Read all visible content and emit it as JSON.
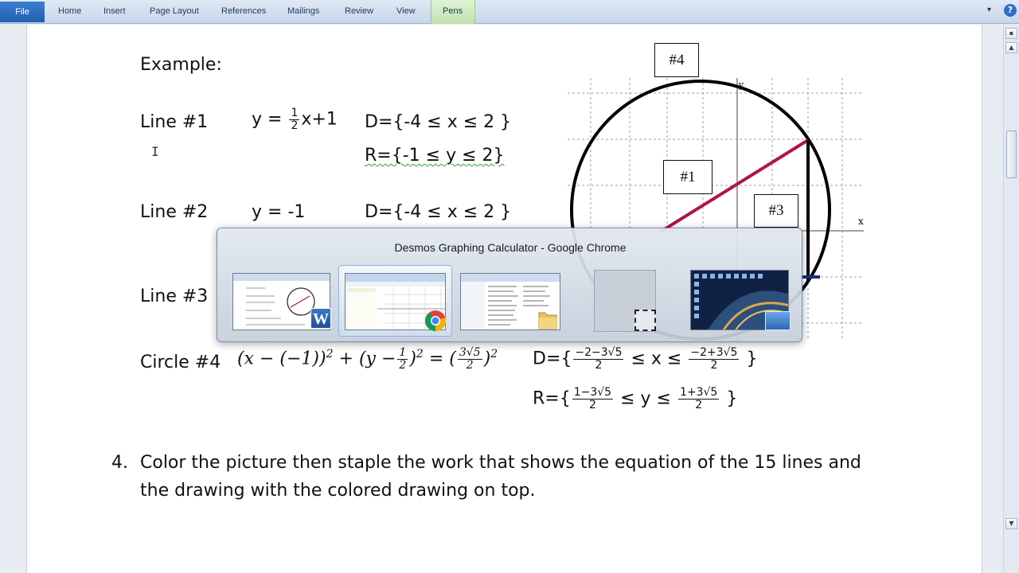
{
  "ribbon": {
    "file_tab": "File",
    "tabs": [
      "Home",
      "Insert",
      "Page Layout",
      "References",
      "Mailings",
      "Review",
      "View"
    ],
    "pens_tab": "Pens"
  },
  "document": {
    "example_heading": "Example:",
    "line1": {
      "label": "Line #1",
      "eq_prefix": "y = ",
      "frac_num": "1",
      "frac_den": "2",
      "eq_suffix": "x+1",
      "domain": "D={-4 ≤ x ≤ 2 }",
      "range": "R={-1 ≤ y ≤ 2}"
    },
    "line2": {
      "label": "Line #2",
      "equation": "y = -1",
      "domain": "D={-4 ≤ x ≤ 2 }"
    },
    "line3": {
      "label": "Line #3"
    },
    "circle4": {
      "label": "Circle #4",
      "eq_part1": "(x − (−1))",
      "exp1": "2",
      "eq_part2": "+ (y −",
      "half_num": "1",
      "half_den": "2",
      "eq_part3": ")",
      "exp2": "2",
      "eq_equals": "=",
      "rhs_num": "3√5",
      "rhs_den": "2",
      "exp3": "2",
      "domain_prefix": "D={",
      "domain_left_num": "−2−3√5",
      "domain_left_den": "2",
      "domain_mid": "≤ x ≤",
      "domain_right_num": "−2+3√5",
      "domain_right_den": "2",
      "domain_close": "}",
      "range_prefix": "R={",
      "range_left_num": "1−3√5",
      "range_left_den": "2",
      "range_mid": "≤ y ≤",
      "range_right_num": "1+3√5",
      "range_right_den": "2",
      "range_close": "}"
    },
    "step4": {
      "number": "4.",
      "line_a": "Color the picture then staple the work that shows the equation of the 15 lines and",
      "line_b": "the drawing with the colored drawing on top."
    }
  },
  "graph": {
    "labels": {
      "l4": "#4",
      "l1": "#1",
      "l3": "#3"
    },
    "axis_x": "x",
    "axis_y": "y",
    "colors": {
      "line1": "#b0124e",
      "line2": "#1a2a8c",
      "circle": "#000000",
      "line3": "#000000"
    }
  },
  "switcher": {
    "title": "Desmos Graphing Calculator - Google Chrome",
    "items": [
      "word-window",
      "chrome-window",
      "explorer-window",
      "blank-window",
      "desktop"
    ]
  }
}
